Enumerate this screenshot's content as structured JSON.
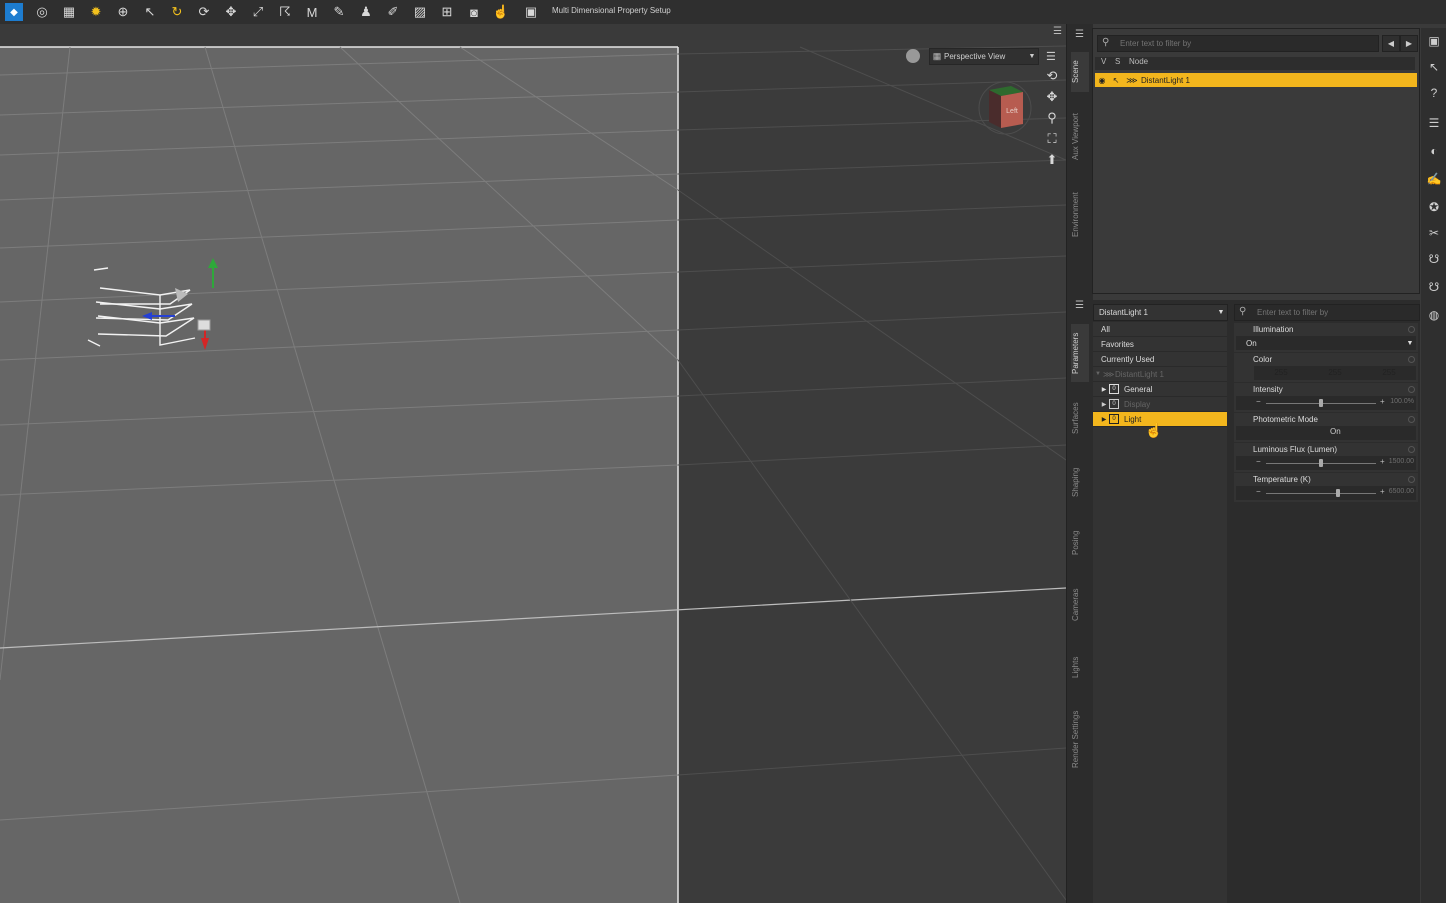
{
  "toolbar": {
    "title": "Multi Dimensional Property Setup",
    "icons": [
      "daz-logo-icon",
      "target-icon",
      "film-icon",
      "light-bulb-icon",
      "universal-tool-icon",
      "pointer-icon",
      "joint-icon",
      "rotate-icon",
      "translate-icon",
      "scale-icon",
      "node-weight-icon",
      "morph-icon",
      "geometry-editor-icon",
      "figure-icon",
      "spot-render-icon",
      "surface-selection-icon",
      "region-icon",
      "camera-tool-icon",
      "pose-tool-icon",
      "render-icon"
    ]
  },
  "viewport": {
    "view_label": "Perspective View",
    "nav_cube_label": "Left"
  },
  "dock_tabs": {
    "upper": [
      "Scene",
      "Aux Viewport",
      "Environment"
    ],
    "lower": [
      "Parameters",
      "Surfaces",
      "Shaping",
      "Posing",
      "Cameras",
      "Lights",
      "Render Settings"
    ]
  },
  "scene": {
    "search_placeholder": "Enter text to filter by",
    "col_v": "V",
    "col_s": "S",
    "col_node": "Node",
    "selected_node": "DistantLight 1"
  },
  "parameters": {
    "node_select": "DistantLight 1",
    "groups": [
      {
        "label": "All"
      },
      {
        "label": "Favorites"
      },
      {
        "label": "Currently Used"
      },
      {
        "label": "DistantLight 1"
      },
      {
        "label": "General"
      },
      {
        "label": "Display"
      },
      {
        "label": "Light"
      }
    ],
    "search_placeholder": "Enter text to filter by",
    "props": {
      "illumination": {
        "label": "Illumination",
        "value": "On"
      },
      "color": {
        "label": "Color",
        "r": "255",
        "g": "255",
        "b": "255"
      },
      "intensity": {
        "label": "Intensity",
        "value": "100.0%",
        "level": 0.5
      },
      "photometric": {
        "label": "Photometric Mode",
        "value": "On"
      },
      "flux": {
        "label": "Luminous Flux (Lumen)",
        "value": "1500.00",
        "level": 0.5
      },
      "temperature": {
        "label": "Temperature (K)",
        "value": "6500.00",
        "level": 0.65
      }
    }
  },
  "colors": {
    "accent": "#f3b61d",
    "viewport_bg": "#3b3b3b",
    "grid_light": "#7d7d7d"
  }
}
